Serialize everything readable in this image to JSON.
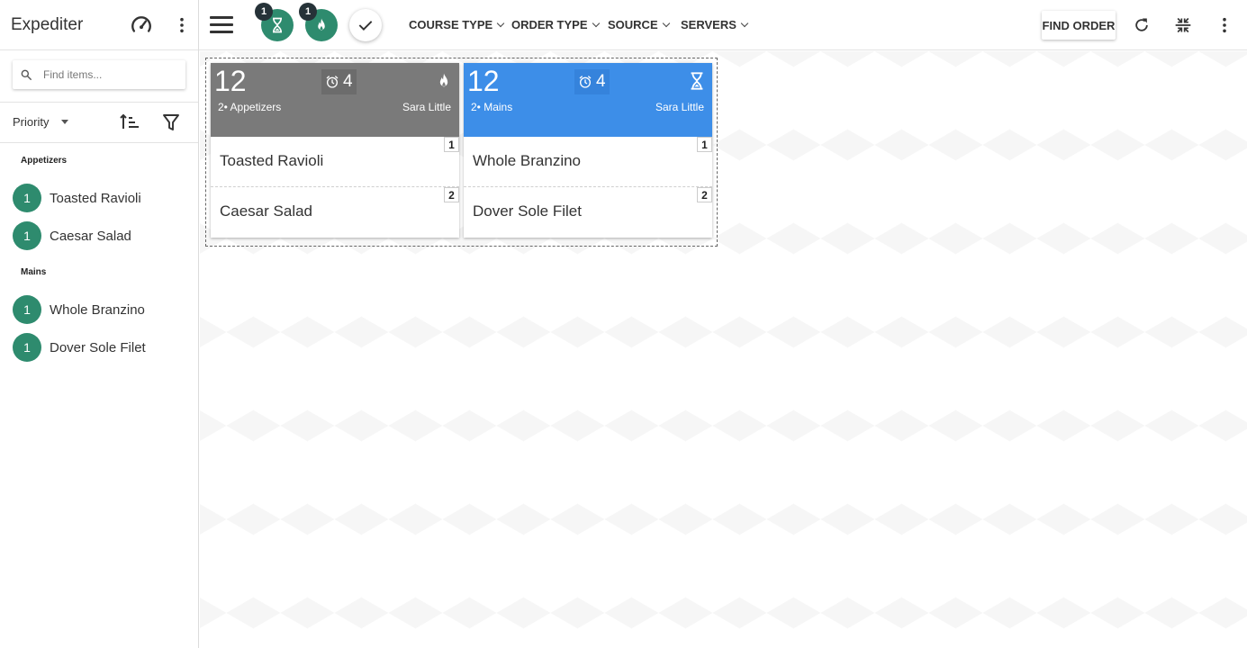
{
  "app": {
    "title": "Expediter"
  },
  "sidebar": {
    "search_placeholder": "Find items...",
    "sort_label": "Priority",
    "groups": [
      {
        "label": "Appetizers",
        "items": [
          {
            "qty": "1",
            "name": "Toasted Ravioli"
          },
          {
            "qty": "1",
            "name": "Caesar Salad"
          }
        ]
      },
      {
        "label": "Mains",
        "items": [
          {
            "qty": "1",
            "name": "Whole Branzino"
          },
          {
            "qty": "1",
            "name": "Dover Sole Filet"
          }
        ]
      }
    ]
  },
  "topbar": {
    "waiting_badge": "1",
    "fire_badge": "1",
    "filters": [
      "COURSE TYPE",
      "ORDER TYPE",
      "SOURCE",
      "SERVERS"
    ],
    "find_order": "FIND ORDER"
  },
  "tickets": [
    {
      "number": "12",
      "timer": "4",
      "course": "2• Appetizers",
      "server": "Sara Little",
      "status_icon": "fire-icon",
      "header_color": "#7a7a7a",
      "items": [
        {
          "name": "Toasted Ravioli",
          "seat": "1"
        },
        {
          "name": "Caesar Salad",
          "seat": "2"
        }
      ]
    },
    {
      "number": "12",
      "timer": "4",
      "course": "2• Mains",
      "server": "Sara Little",
      "status_icon": "hourglass-icon",
      "header_color": "#3d8ee8",
      "items": [
        {
          "name": "Whole Branzino",
          "seat": "1"
        },
        {
          "name": "Dover Sole Filet",
          "seat": "2"
        }
      ]
    }
  ],
  "colors": {
    "accent_green": "#2e8b6e",
    "ticket_gray": "#7a7a7a",
    "ticket_blue": "#3d8ee8",
    "badge_dark": "#263238"
  }
}
